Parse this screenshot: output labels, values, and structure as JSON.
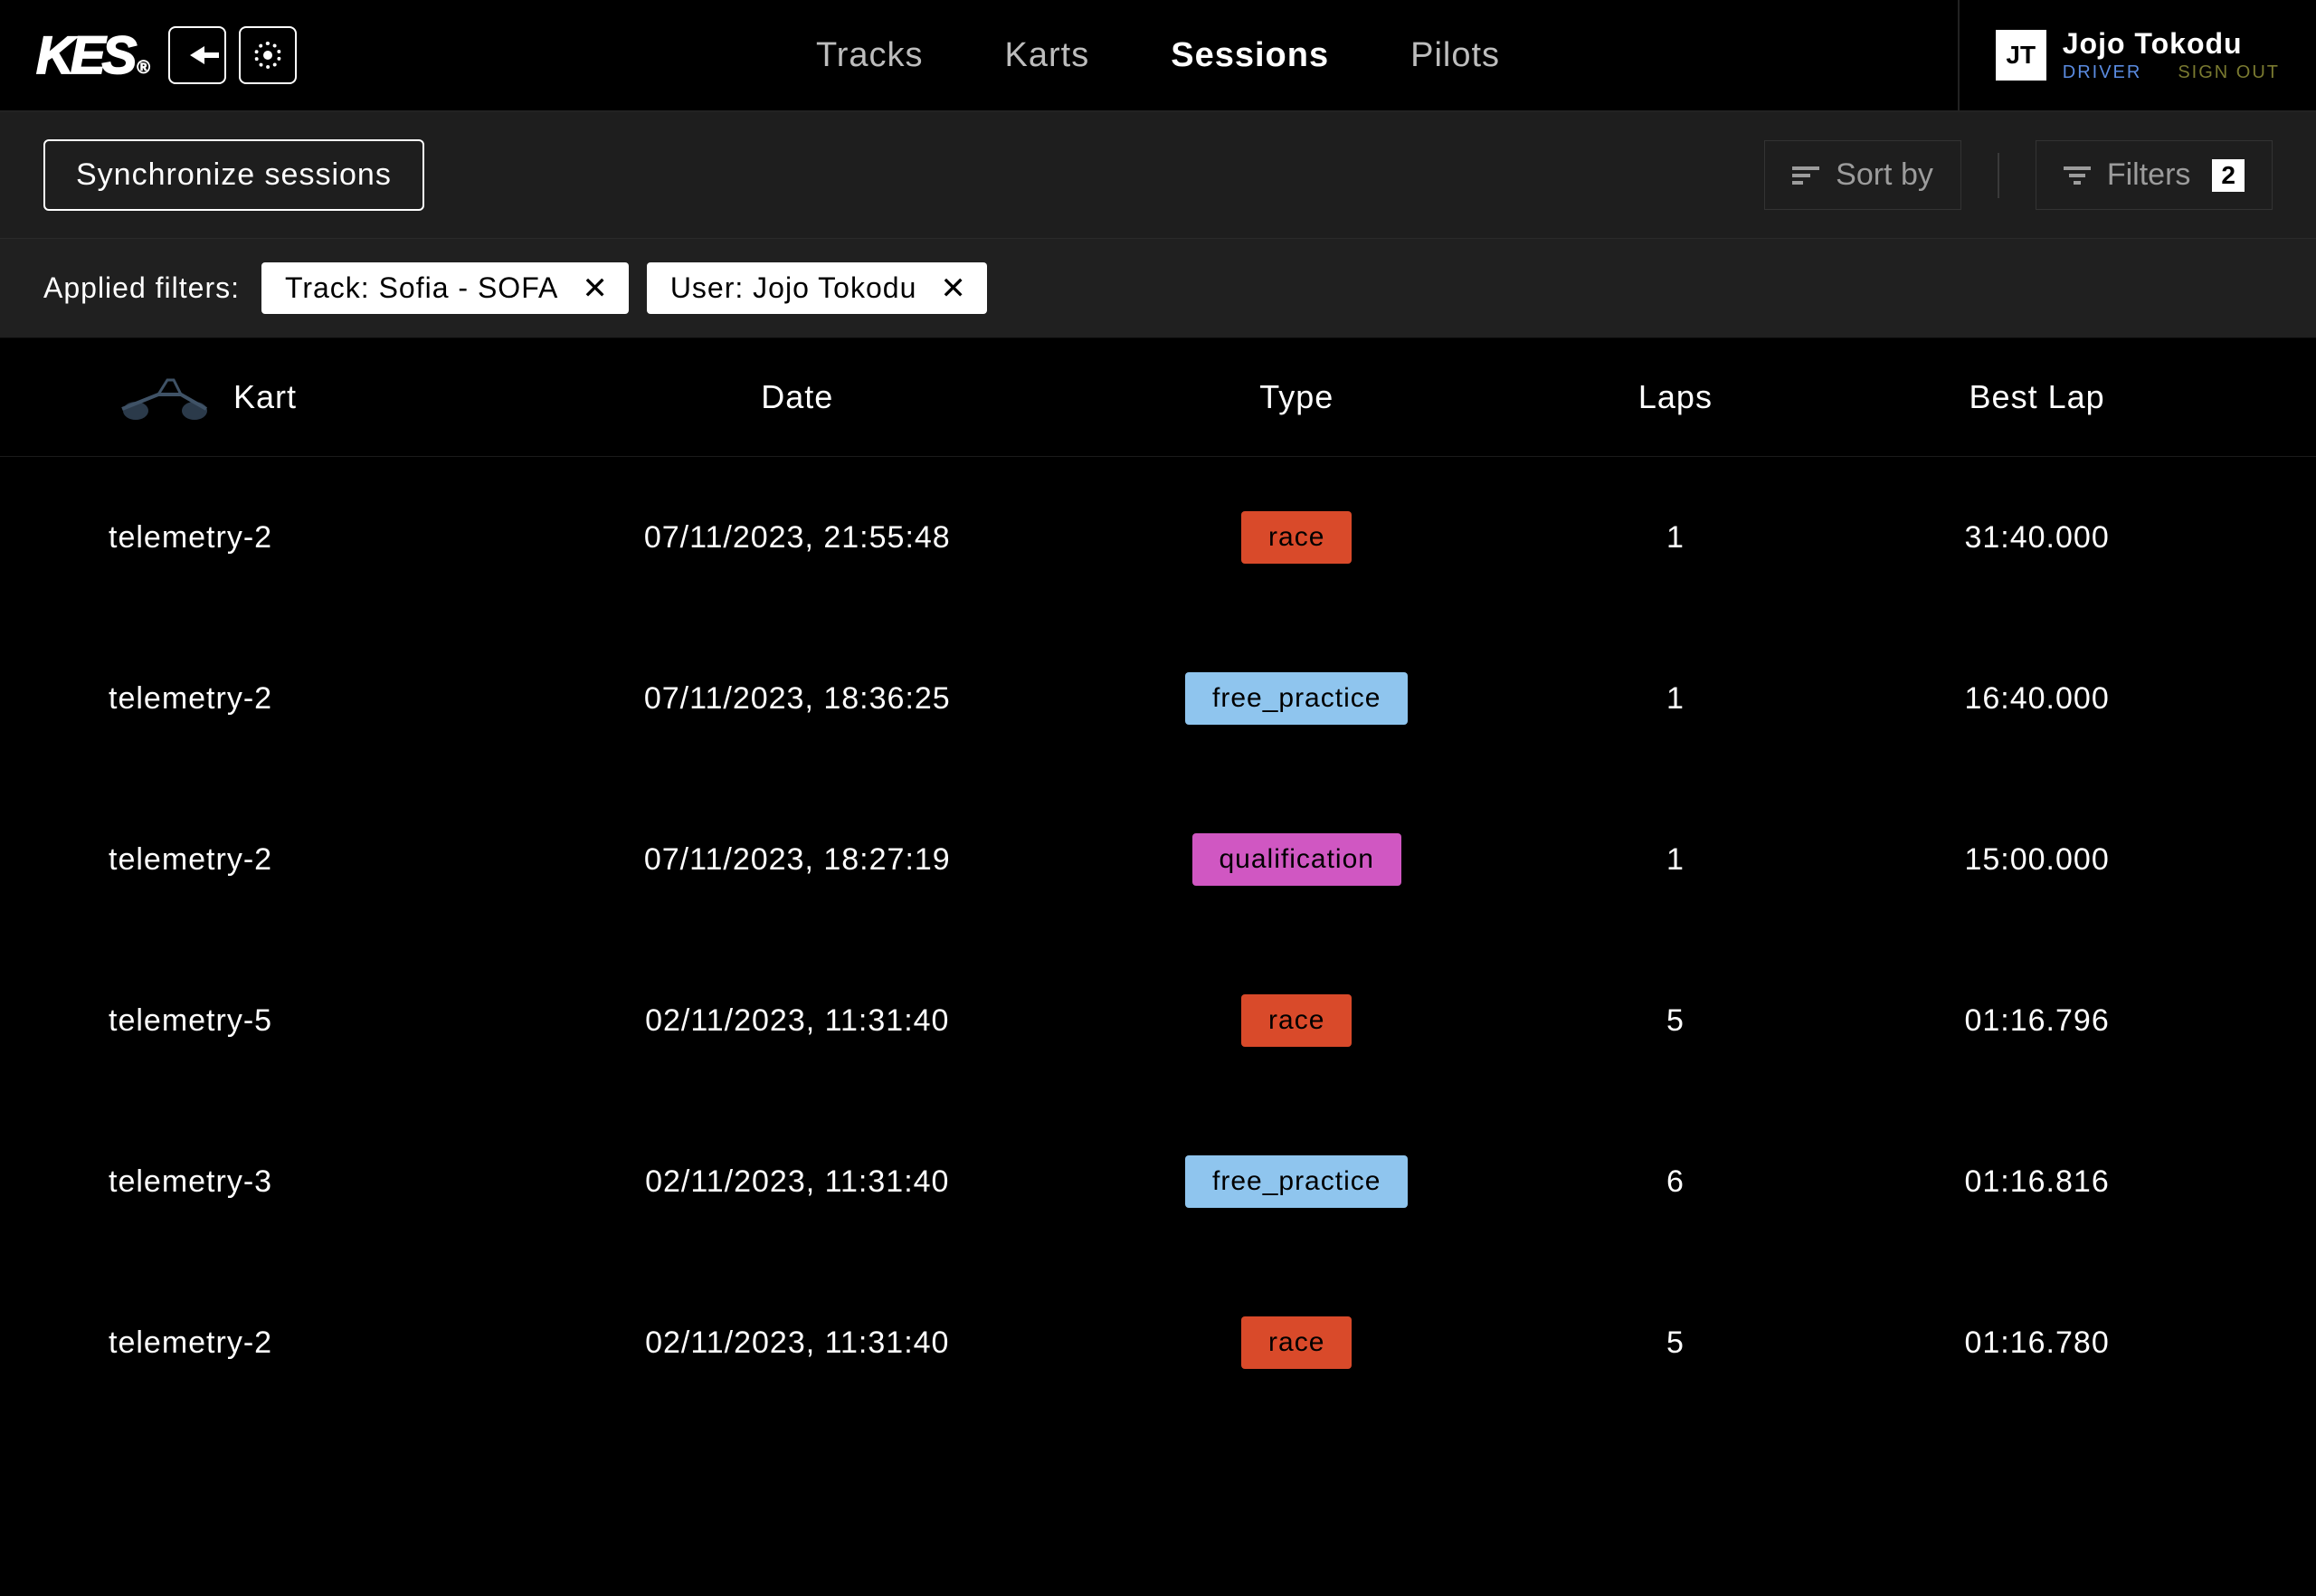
{
  "logo": "KES",
  "nav": {
    "tracks": "Tracks",
    "karts": "Karts",
    "sessions": "Sessions",
    "pilots": "Pilots",
    "active": "sessions"
  },
  "user": {
    "initials": "JT",
    "name": "Jojo Tokodu",
    "role": "DRIVER",
    "signout": "SIGN OUT"
  },
  "toolbar": {
    "sync_label": "Synchronize sessions",
    "sort_label": "Sort by",
    "filters_label": "Filters",
    "filters_count": "2"
  },
  "applied_filters": {
    "label": "Applied filters:",
    "chips": [
      {
        "text": "Track: Sofia - SOFA"
      },
      {
        "text": "User: Jojo Tokodu"
      }
    ]
  },
  "table": {
    "headers": {
      "kart": "Kart",
      "date": "Date",
      "type": "Type",
      "laps": "Laps",
      "best_lap": "Best Lap"
    },
    "rows": [
      {
        "kart": "telemetry-2",
        "date": "07/11/2023, 21:55:48",
        "type": "race",
        "type_label": "race",
        "laps": "1",
        "best_lap": "31:40.000"
      },
      {
        "kart": "telemetry-2",
        "date": "07/11/2023, 18:36:25",
        "type": "free_practice",
        "type_label": "free_practice",
        "laps": "1",
        "best_lap": "16:40.000"
      },
      {
        "kart": "telemetry-2",
        "date": "07/11/2023, 18:27:19",
        "type": "qualification",
        "type_label": "qualification",
        "laps": "1",
        "best_lap": "15:00.000"
      },
      {
        "kart": "telemetry-5",
        "date": "02/11/2023, 11:31:40",
        "type": "race",
        "type_label": "race",
        "laps": "5",
        "best_lap": "01:16.796"
      },
      {
        "kart": "telemetry-3",
        "date": "02/11/2023, 11:31:40",
        "type": "free_practice",
        "type_label": "free_practice",
        "laps": "6",
        "best_lap": "01:16.816"
      },
      {
        "kart": "telemetry-2",
        "date": "02/11/2023, 11:31:40",
        "type": "race",
        "type_label": "race",
        "laps": "5",
        "best_lap": "01:16.780"
      }
    ]
  }
}
